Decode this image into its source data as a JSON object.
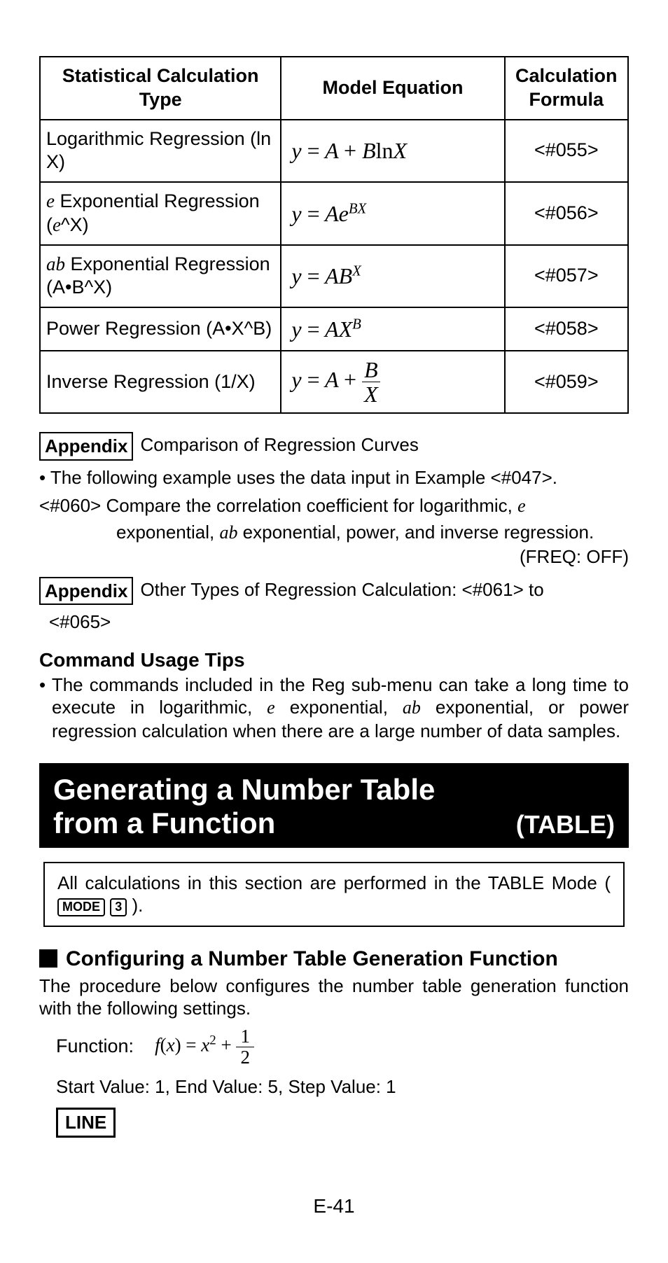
{
  "table": {
    "headers": [
      "Statistical Calculation Type",
      "Model Equation",
      "Calculation Formula"
    ],
    "rows": [
      {
        "type": "Logarithmic Regression (ln X)",
        "formula": "<#055>"
      },
      {
        "type_prefix": "e",
        "type_rest": " Exponential Regression (",
        "type_ital2": "e",
        "type_tail": "^X)",
        "formula": "<#056>"
      },
      {
        "type_prefix": "ab",
        "type_rest": " Exponential Regression (A•B^X)",
        "formula": "<#057>"
      },
      {
        "type": "Power Regression (A•X^B)",
        "formula": "<#058>"
      },
      {
        "type": "Inverse Regression (1/X)",
        "formula": "<#059>"
      }
    ]
  },
  "appendix1": {
    "label": "Appendix",
    "text": "Comparison of Regression Curves"
  },
  "bullet1": "• The following example uses the data input in Example <#047>.",
  "hang_prefix": "<#060>",
  "hang_l1_a": " Compare the correlation coefficient for logarithmic, ",
  "hang_l1_b": "e",
  "hang_l2_a": "exponential, ",
  "hang_l2_b": "ab",
  "hang_l2_c": " exponential, power, and inverse regression.",
  "freq": "(FREQ: OFF)",
  "appendix2": {
    "label": "Appendix",
    "text": "Other Types of Regression Calculation: <#061> to"
  },
  "appendix2_tail": "<#065>",
  "cmd_h": "Command Usage Tips",
  "cmd_b_a": "• The commands included in the Reg sub-menu can take a long time to execute in logarithmic, ",
  "cmd_b_b": "e",
  "cmd_b_c": " exponential, ",
  "cmd_b_d": "ab",
  "cmd_b_e": " exponential, or power regression calculation when there are a large number of data samples.",
  "bar_l1": "Generating a Number Table",
  "bar_l2": "from a Function",
  "bar_table": "(TABLE)",
  "note_a": "All calculations in this section are performed in the TABLE Mode ( ",
  "note_key1": "MODE",
  "note_key2": "3",
  "note_b": " ).",
  "subh": "Configuring a Number Table Generation Function",
  "para": "The procedure below configures the number table generation function with the following settings.",
  "fn_label": "Function:",
  "vals": "Start Value: 1, End Value: 5, Step Value: 1",
  "line": "LINE",
  "pagenum": "E-41",
  "chart_data": {
    "type": "table",
    "title": "Regression model equations",
    "columns": [
      "Statistical Calculation Type",
      "Model Equation",
      "Calculation Formula"
    ],
    "rows": [
      [
        "Logarithmic Regression (ln X)",
        "y = A + B ln X",
        "<#055>"
      ],
      [
        "e Exponential Regression (e^X)",
        "y = A e^{BX}",
        "<#056>"
      ],
      [
        "ab Exponential Regression (A·B^X)",
        "y = A B^X",
        "<#057>"
      ],
      [
        "Power Regression (A·X^B)",
        "y = A X^B",
        "<#058>"
      ],
      [
        "Inverse Regression (1/X)",
        "y = A + B/X",
        "<#059>"
      ]
    ]
  },
  "function_def": {
    "fx": "f(x) = x^2 + 1/2",
    "start": 1,
    "end": 5,
    "step": 1
  }
}
